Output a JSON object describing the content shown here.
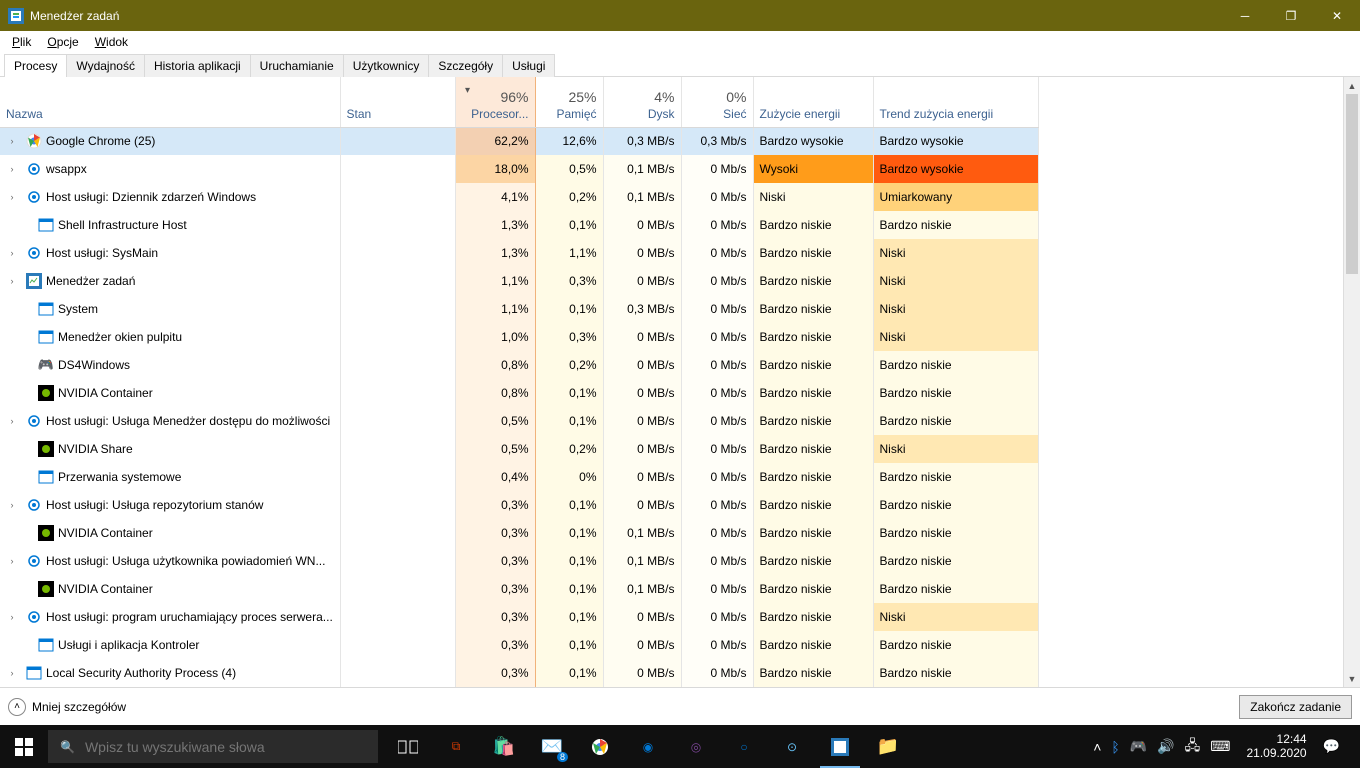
{
  "title": "Menedżer zadań",
  "menu": [
    "Plik",
    "Opcje",
    "Widok"
  ],
  "tabs": [
    "Procesy",
    "Wydajność",
    "Historia aplikacji",
    "Uruchamianie",
    "Użytkownicy",
    "Szczegóły",
    "Usługi"
  ],
  "active_tab": 0,
  "columns": {
    "name": "Nazwa",
    "status": "Stan",
    "cpu": "Procesor...",
    "mem": "Pamięć",
    "disk": "Dysk",
    "net": "Sieć",
    "pow": "Zużycie energii",
    "trend": "Trend zużycia energii"
  },
  "column_totals": {
    "cpu": "96%",
    "mem": "25%",
    "disk": "4%",
    "net": "0%"
  },
  "sort_column": "cpu",
  "processes": [
    {
      "exp": true,
      "icon": "chrome",
      "name": "Google Chrome (25)",
      "cpu": "62,2%",
      "mem": "12,6%",
      "disk": "0,3 MB/s",
      "net": "0,3 Mb/s",
      "pow": "Bardzo wysokie",
      "trend": "Bardzo wysokie",
      "sel": true,
      "pow_c": "sel",
      "trend_c": "vhigh"
    },
    {
      "exp": true,
      "icon": "gear",
      "name": "wsappx",
      "cpu": "18,0%",
      "mem": "0,5%",
      "disk": "0,1 MB/s",
      "net": "0 Mb/s",
      "pow": "Wysoki",
      "trend": "Bardzo wysokie",
      "pow_c": "high",
      "trend_c": "vhigh",
      "cpu_h": 2
    },
    {
      "exp": true,
      "icon": "gear",
      "name": "Host usługi: Dziennik zdarzeń Windows",
      "cpu": "4,1%",
      "mem": "0,2%",
      "disk": "0,1 MB/s",
      "net": "0 Mb/s",
      "pow": "Niski",
      "trend": "Umiarkowany",
      "trend_c": "heat-2"
    },
    {
      "exp": false,
      "icon": "win",
      "name": "Shell Infrastructure Host",
      "cpu": "1,3%",
      "mem": "0,1%",
      "disk": "0 MB/s",
      "net": "0 Mb/s",
      "pow": "Bardzo niskie",
      "trend": "Bardzo niskie"
    },
    {
      "exp": true,
      "icon": "gear",
      "name": "Host usługi: SysMain",
      "cpu": "1,3%",
      "mem": "1,1%",
      "disk": "0 MB/s",
      "net": "0 Mb/s",
      "pow": "Bardzo niskie",
      "trend": "Niski",
      "trend_c": "heat-1"
    },
    {
      "exp": true,
      "icon": "tm",
      "name": "Menedżer zadań",
      "cpu": "1,1%",
      "mem": "0,3%",
      "disk": "0 MB/s",
      "net": "0 Mb/s",
      "pow": "Bardzo niskie",
      "trend": "Niski",
      "trend_c": "heat-1"
    },
    {
      "exp": false,
      "icon": "win",
      "name": "System",
      "cpu": "1,1%",
      "mem": "0,1%",
      "disk": "0,3 MB/s",
      "net": "0 Mb/s",
      "pow": "Bardzo niskie",
      "trend": "Niski",
      "trend_c": "heat-1"
    },
    {
      "exp": false,
      "icon": "win",
      "name": "Menedżer okien pulpitu",
      "cpu": "1,0%",
      "mem": "0,3%",
      "disk": "0 MB/s",
      "net": "0 Mb/s",
      "pow": "Bardzo niskie",
      "trend": "Niski",
      "trend_c": "heat-1"
    },
    {
      "exp": false,
      "icon": "pad",
      "name": "DS4Windows",
      "cpu": "0,8%",
      "mem": "0,2%",
      "disk": "0 MB/s",
      "net": "0 Mb/s",
      "pow": "Bardzo niskie",
      "trend": "Bardzo niskie"
    },
    {
      "exp": false,
      "icon": "nv",
      "name": "NVIDIA Container",
      "cpu": "0,8%",
      "mem": "0,1%",
      "disk": "0 MB/s",
      "net": "0 Mb/s",
      "pow": "Bardzo niskie",
      "trend": "Bardzo niskie"
    },
    {
      "exp": true,
      "icon": "gear",
      "name": "Host usługi: Usługa Menedżer dostępu do możliwości",
      "cpu": "0,5%",
      "mem": "0,1%",
      "disk": "0 MB/s",
      "net": "0 Mb/s",
      "pow": "Bardzo niskie",
      "trend": "Bardzo niskie"
    },
    {
      "exp": false,
      "icon": "nv",
      "name": "NVIDIA Share",
      "cpu": "0,5%",
      "mem": "0,2%",
      "disk": "0 MB/s",
      "net": "0 Mb/s",
      "pow": "Bardzo niskie",
      "trend": "Niski",
      "trend_c": "heat-1"
    },
    {
      "exp": false,
      "icon": "win",
      "name": "Przerwania systemowe",
      "cpu": "0,4%",
      "mem": "0%",
      "disk": "0 MB/s",
      "net": "0 Mb/s",
      "pow": "Bardzo niskie",
      "trend": "Bardzo niskie"
    },
    {
      "exp": true,
      "icon": "gear",
      "name": "Host usługi: Usługa repozytorium stanów",
      "cpu": "0,3%",
      "mem": "0,1%",
      "disk": "0 MB/s",
      "net": "0 Mb/s",
      "pow": "Bardzo niskie",
      "trend": "Bardzo niskie"
    },
    {
      "exp": false,
      "icon": "nv",
      "name": "NVIDIA Container",
      "cpu": "0,3%",
      "mem": "0,1%",
      "disk": "0,1 MB/s",
      "net": "0 Mb/s",
      "pow": "Bardzo niskie",
      "trend": "Bardzo niskie"
    },
    {
      "exp": true,
      "icon": "gear",
      "name": "Host usługi: Usługa użytkownika powiadomień WN...",
      "cpu": "0,3%",
      "mem": "0,1%",
      "disk": "0,1 MB/s",
      "net": "0 Mb/s",
      "pow": "Bardzo niskie",
      "trend": "Bardzo niskie"
    },
    {
      "exp": false,
      "icon": "nv",
      "name": "NVIDIA Container",
      "cpu": "0,3%",
      "mem": "0,1%",
      "disk": "0,1 MB/s",
      "net": "0 Mb/s",
      "pow": "Bardzo niskie",
      "trend": "Bardzo niskie"
    },
    {
      "exp": true,
      "icon": "gear",
      "name": "Host usługi: program uruchamiający proces serwera...",
      "cpu": "0,3%",
      "mem": "0,1%",
      "disk": "0 MB/s",
      "net": "0 Mb/s",
      "pow": "Bardzo niskie",
      "trend": "Niski",
      "trend_c": "heat-1"
    },
    {
      "exp": false,
      "icon": "win",
      "name": "Usługi i aplikacja Kontroler",
      "cpu": "0,3%",
      "mem": "0,1%",
      "disk": "0 MB/s",
      "net": "0 Mb/s",
      "pow": "Bardzo niskie",
      "trend": "Bardzo niskie"
    },
    {
      "exp": true,
      "icon": "win",
      "name": "Local Security Authority Process (4)",
      "cpu": "0,3%",
      "mem": "0,1%",
      "disk": "0 MB/s",
      "net": "0 Mb/s",
      "pow": "Bardzo niskie",
      "trend": "Bardzo niskie"
    }
  ],
  "footer": {
    "less": "Mniej szczegółów",
    "end": "Zakończ zadanie"
  },
  "taskbar": {
    "search_placeholder": "Wpisz tu wyszukiwane słowa",
    "time": "12:44",
    "date": "21.09.2020"
  }
}
